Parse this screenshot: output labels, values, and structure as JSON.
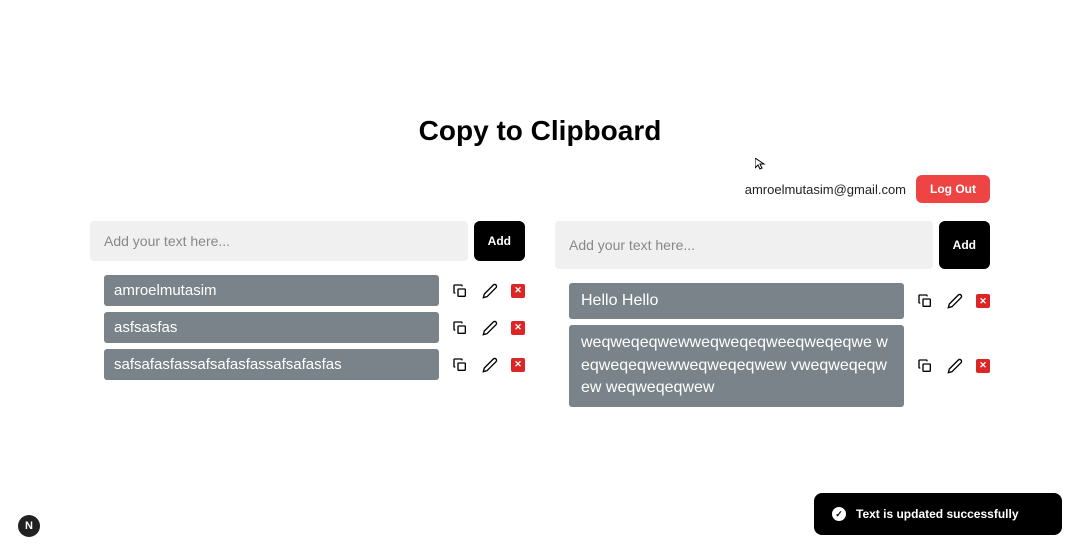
{
  "title": "Copy to Clipboard",
  "user": {
    "email": "amroelmutasim@gmail.com"
  },
  "buttons": {
    "logout": "Log Out",
    "add": "Add"
  },
  "inputs": {
    "placeholder": "Add your text here..."
  },
  "columns": [
    {
      "items": [
        {
          "text": "amroelmutasim"
        },
        {
          "text": "asfsasfas"
        },
        {
          "text": "safsafasfassafsafasfassafsafasfas"
        }
      ]
    },
    {
      "items": [
        {
          "text": "Hello Hello"
        },
        {
          "text": "weqweqeqwewweqweqeqweeqweqeqwe weqweqeqwewweqweqeqwew vweqweqeqwew weqweqeqwew"
        }
      ]
    }
  ],
  "toast": {
    "message": "Text is updated successfully"
  },
  "badge": {
    "label": "N"
  }
}
